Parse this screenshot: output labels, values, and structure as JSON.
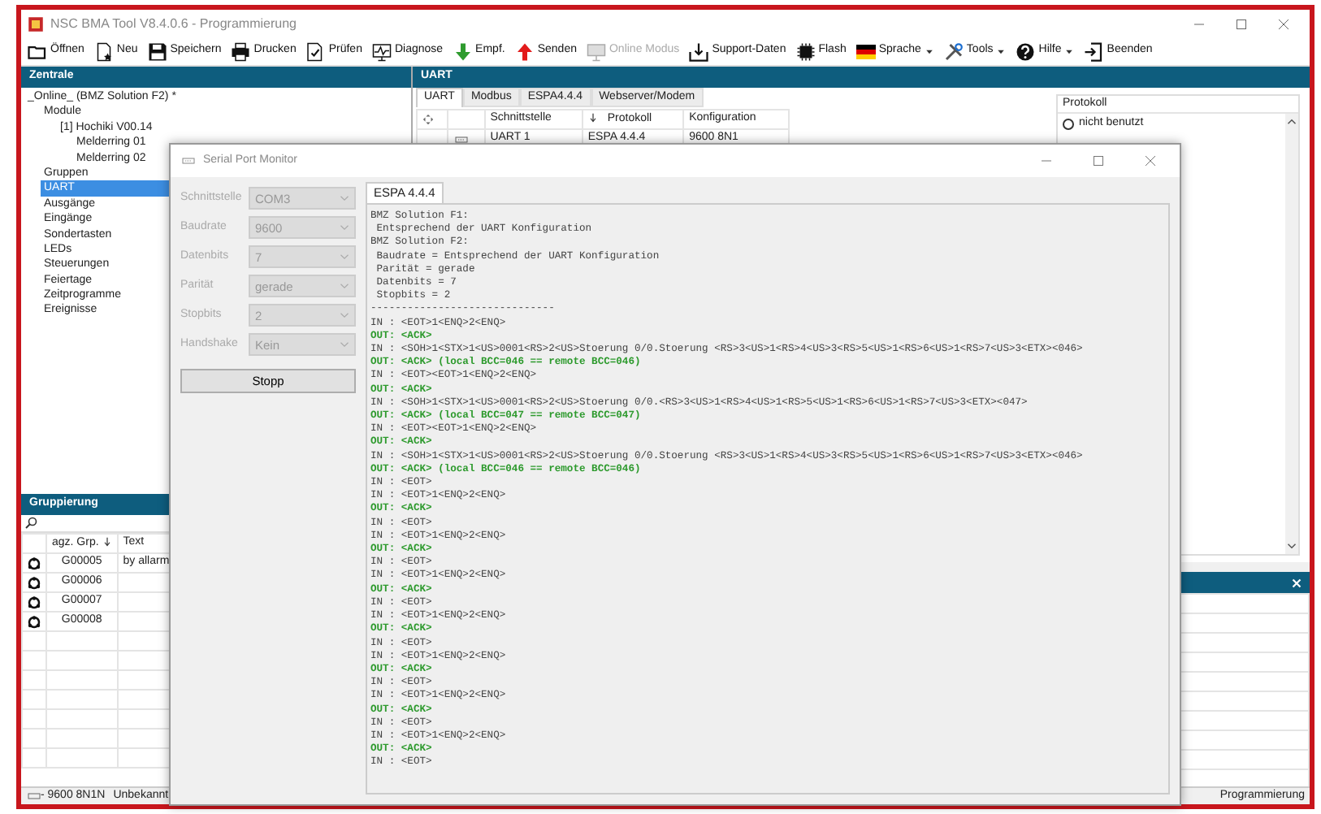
{
  "window": {
    "title": "NSC BMA Tool V8.4.0.6 - Programmierung"
  },
  "toolbar": [
    {
      "label": "Öffnen",
      "disabled": false,
      "has_menu": false
    },
    {
      "label": "Neu",
      "disabled": false,
      "has_menu": false
    },
    {
      "label": "Speichern",
      "disabled": false,
      "has_menu": false
    },
    {
      "label": "Drucken",
      "disabled": false,
      "has_menu": false
    },
    {
      "label": "Prüfen",
      "disabled": false,
      "has_menu": false
    },
    {
      "label": "Diagnose",
      "disabled": false,
      "has_menu": false
    },
    {
      "label": "Empf.",
      "disabled": false,
      "has_menu": false
    },
    {
      "label": "Senden",
      "disabled": false,
      "has_menu": false
    },
    {
      "label": "Online Modus",
      "disabled": true,
      "has_menu": false
    },
    {
      "label": "Support-Daten",
      "disabled": false,
      "has_menu": false
    },
    {
      "label": "Flash",
      "disabled": false,
      "has_menu": false
    },
    {
      "label": "Sprache",
      "disabled": false,
      "has_menu": true
    },
    {
      "label": "Tools",
      "disabled": false,
      "has_menu": true
    },
    {
      "label": "Hilfe",
      "disabled": false,
      "has_menu": true
    },
    {
      "label": "Beenden",
      "disabled": false,
      "has_menu": false
    }
  ],
  "zentrale": {
    "title": "Zentrale",
    "tree": [
      {
        "label": "_Online_ (BMZ Solution F2) *",
        "selected": false,
        "children": [
          {
            "label": "Module",
            "selected": false,
            "children": [
              {
                "label": "[1] Hochiki V00.14",
                "selected": false,
                "children": [
                  {
                    "label": "Melderring 01",
                    "selected": false
                  },
                  {
                    "label": "Melderring 02",
                    "selected": false
                  }
                ]
              }
            ]
          },
          {
            "label": "Gruppen",
            "selected": false
          },
          {
            "label": "UART",
            "selected": true
          },
          {
            "label": "Ausgänge",
            "selected": false
          },
          {
            "label": "Eingänge",
            "selected": false
          },
          {
            "label": "Sondertasten",
            "selected": false
          },
          {
            "label": "LEDs",
            "selected": false
          },
          {
            "label": "Steuerungen",
            "selected": false
          },
          {
            "label": "Feiertage",
            "selected": false
          },
          {
            "label": "Zeitprogramme",
            "selected": false
          },
          {
            "label": "Ereignisse",
            "selected": false
          }
        ]
      }
    ]
  },
  "gruppierung": {
    "title": "Gruppierung",
    "columns": [
      "agz. Grp.",
      "Text"
    ],
    "rows": [
      {
        "cells": [
          "G00005",
          "by allarm"
        ]
      },
      {
        "cells": [
          "G00006",
          ""
        ]
      },
      {
        "cells": [
          "G00007",
          ""
        ]
      },
      {
        "cells": [
          "G00008",
          ""
        ]
      }
    ]
  },
  "uart": {
    "title": "UART",
    "tabs": [
      {
        "label": "UART",
        "selected": true
      },
      {
        "label": "Modbus",
        "selected": false
      },
      {
        "label": "ESPA4.4.4",
        "selected": false
      },
      {
        "label": "Webserver/Modem",
        "selected": false
      }
    ],
    "columns": [
      "Schnittstelle",
      "Protokoll",
      "Konfiguration"
    ],
    "rows": [
      {
        "cells": [
          "UART 1",
          "ESPA 4.4.4",
          "9600 8N1"
        ]
      }
    ],
    "protocol": {
      "label": "Protokoll",
      "options": [
        {
          "label": "nicht benutzt",
          "selected": false
        }
      ]
    }
  },
  "status_bar": {
    "port": "- 9600 8N1N",
    "state": "Unbekannt",
    "mode": "Programmierung"
  },
  "serial_monitor": {
    "title": "Serial Port Monitor",
    "fields": [
      {
        "label": "Schnittstelle",
        "value": "COM3",
        "disabled": true
      },
      {
        "label": "Baudrate",
        "value": "9600",
        "disabled": true
      },
      {
        "label": "Datenbits",
        "value": "7",
        "disabled": true
      },
      {
        "label": "Parität",
        "value": "gerade",
        "disabled": true
      },
      {
        "label": "Stopbits",
        "value": "2",
        "disabled": true
      },
      {
        "label": "Handshake",
        "value": "Kein",
        "disabled": true
      }
    ],
    "button": "Stopp",
    "tab": "ESPA 4.4.4",
    "log": [
      {
        "kind": "info",
        "text": "BMZ Solution F1:"
      },
      {
        "kind": "info",
        "text": " Entsprechend der UART Konfiguration"
      },
      {
        "kind": "info",
        "text": "BMZ Solution F2:"
      },
      {
        "kind": "info",
        "text": " Baudrate = Entsprechend der UART Konfiguration"
      },
      {
        "kind": "info",
        "text": " Parität = gerade"
      },
      {
        "kind": "info",
        "text": " Datenbits = 7"
      },
      {
        "kind": "info",
        "text": " Stopbits = 2"
      },
      {
        "kind": "info",
        "text": "------------------------------"
      },
      {
        "kind": "in",
        "text": "IN : <EOT>1<ENQ>2<ENQ>"
      },
      {
        "kind": "out",
        "text": "OUT: <ACK>"
      },
      {
        "kind": "in",
        "text": "IN : <SOH>1<STX>1<US>0001<RS>2<US>Stoerung 0/0.Stoerung <RS>3<US>1<RS>4<US>3<RS>5<US>1<RS>6<US>1<RS>7<US>3<ETX><046>"
      },
      {
        "kind": "out",
        "text": "OUT: <ACK> (local BCC=046 == remote BCC=046)"
      },
      {
        "kind": "in",
        "text": "IN : <EOT><EOT>1<ENQ>2<ENQ>"
      },
      {
        "kind": "out",
        "text": "OUT: <ACK>"
      },
      {
        "kind": "in",
        "text": "IN : <SOH>1<STX>1<US>0001<RS>2<US>Stoerung 0/0.<RS>3<US>1<RS>4<US>1<RS>5<US>1<RS>6<US>1<RS>7<US>3<ETX><047>"
      },
      {
        "kind": "out",
        "text": "OUT: <ACK> (local BCC=047 == remote BCC=047)"
      },
      {
        "kind": "in",
        "text": "IN : <EOT><EOT>1<ENQ>2<ENQ>"
      },
      {
        "kind": "out",
        "text": "OUT: <ACK>"
      },
      {
        "kind": "in",
        "text": "IN : <SOH>1<STX>1<US>0001<RS>2<US>Stoerung 0/0.Stoerung <RS>3<US>1<RS>4<US>3<RS>5<US>1<RS>6<US>1<RS>7<US>3<ETX><046>"
      },
      {
        "kind": "out",
        "text": "OUT: <ACK> (local BCC=046 == remote BCC=046)"
      },
      {
        "kind": "in",
        "text": "IN : <EOT>"
      },
      {
        "kind": "in",
        "text": "IN : <EOT>1<ENQ>2<ENQ>"
      },
      {
        "kind": "out",
        "text": "OUT: <ACK>"
      },
      {
        "kind": "in",
        "text": "IN : <EOT>"
      },
      {
        "kind": "in",
        "text": "IN : <EOT>1<ENQ>2<ENQ>"
      },
      {
        "kind": "out",
        "text": "OUT: <ACK>"
      },
      {
        "kind": "in",
        "text": "IN : <EOT>"
      },
      {
        "kind": "in",
        "text": "IN : <EOT>1<ENQ>2<ENQ>"
      },
      {
        "kind": "out",
        "text": "OUT: <ACK>"
      },
      {
        "kind": "in",
        "text": "IN : <EOT>"
      },
      {
        "kind": "in",
        "text": "IN : <EOT>1<ENQ>2<ENQ>"
      },
      {
        "kind": "out",
        "text": "OUT: <ACK>"
      },
      {
        "kind": "in",
        "text": "IN : <EOT>"
      },
      {
        "kind": "in",
        "text": "IN : <EOT>1<ENQ>2<ENQ>"
      },
      {
        "kind": "out",
        "text": "OUT: <ACK>"
      },
      {
        "kind": "in",
        "text": "IN : <EOT>"
      },
      {
        "kind": "in",
        "text": "IN : <EOT>1<ENQ>2<ENQ>"
      },
      {
        "kind": "out",
        "text": "OUT: <ACK>"
      },
      {
        "kind": "in",
        "text": "IN : <EOT>"
      },
      {
        "kind": "in",
        "text": "IN : <EOT>1<ENQ>2<ENQ>"
      },
      {
        "kind": "out",
        "text": "OUT: <ACK>"
      },
      {
        "kind": "in",
        "text": "IN : <EOT>"
      }
    ]
  }
}
